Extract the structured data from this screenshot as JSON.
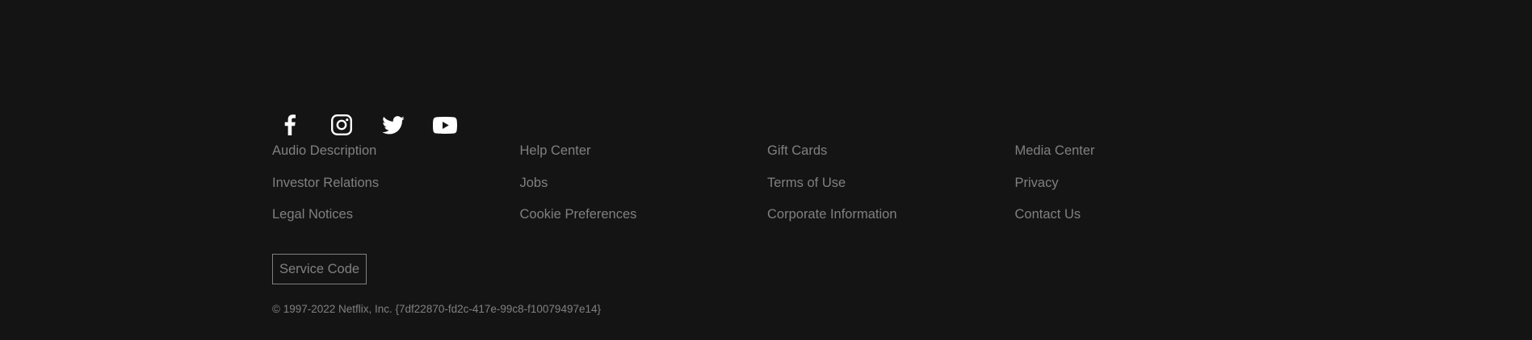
{
  "colors": {
    "background": "#141414",
    "link_text": "#808080",
    "icon": "#ffffff"
  },
  "social": [
    {
      "icon": "facebook-icon"
    },
    {
      "icon": "instagram-icon"
    },
    {
      "icon": "twitter-icon"
    },
    {
      "icon": "youtube-icon"
    }
  ],
  "links": [
    "Audio Description",
    "Help Center",
    "Gift Cards",
    "Media Center",
    "Investor Relations",
    "Jobs",
    "Terms of Use",
    "Privacy",
    "Legal Notices",
    "Cookie Preferences",
    "Corporate Information",
    "Contact Us"
  ],
  "service_code_label": "Service Code",
  "copyright": "© 1997-2022 Netflix, Inc. {7df22870-fd2c-417e-99c8-f10079497e14}"
}
